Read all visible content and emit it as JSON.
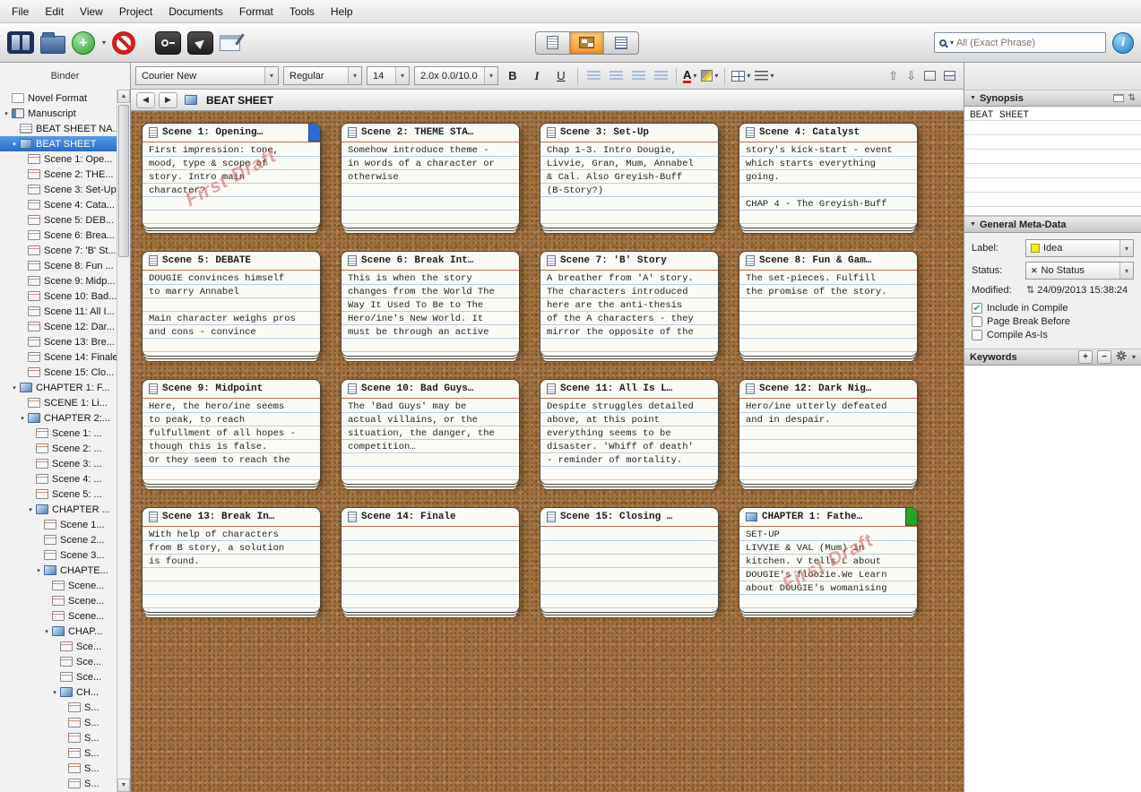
{
  "menubar": {
    "items": [
      "File",
      "Edit",
      "View",
      "Project",
      "Documents",
      "Format",
      "Tools",
      "Help"
    ]
  },
  "toolbar": {
    "search_placeholder": "All (Exact Phrase)",
    "info_label": "i"
  },
  "formatbar": {
    "font": "Courier New",
    "style": "Regular",
    "size": "14",
    "spacing": "2.0x 0.0/10.0",
    "bold": "B",
    "italic": "I",
    "underline": "U",
    "color_letter": "A"
  },
  "editor": {
    "title": "BEAT SHEET"
  },
  "binder": {
    "title": "Binder",
    "items": [
      {
        "label": "Novel Format",
        "depth": 0,
        "icon": "page"
      },
      {
        "label": "Manuscript",
        "depth": 0,
        "icon": "book",
        "children": true
      },
      {
        "label": "BEAT SHEET NA...",
        "depth": 1,
        "icon": "doc"
      },
      {
        "label": "BEAT SHEET",
        "depth": 1,
        "icon": "stack",
        "children": true,
        "selected": true
      },
      {
        "label": "Scene 1: Ope...",
        "depth": 2,
        "icon": "card"
      },
      {
        "label": "Scene 2: THE...",
        "depth": 2,
        "icon": "card"
      },
      {
        "label": "Scene 3: Set-Up",
        "depth": 2,
        "icon": "card"
      },
      {
        "label": "Scene 4: Cata...",
        "depth": 2,
        "icon": "card"
      },
      {
        "label": "Scene 5: DEB...",
        "depth": 2,
        "icon": "card"
      },
      {
        "label": "Scene 6: Brea...",
        "depth": 2,
        "icon": "card"
      },
      {
        "label": "Scene 7: 'B' St...",
        "depth": 2,
        "icon": "card"
      },
      {
        "label": "Scene 8: Fun ...",
        "depth": 2,
        "icon": "card"
      },
      {
        "label": "Scene 9: Midp...",
        "depth": 2,
        "icon": "card"
      },
      {
        "label": "Scene 10: Bad...",
        "depth": 2,
        "icon": "card"
      },
      {
        "label": "Scene 11: All I...",
        "depth": 2,
        "icon": "card"
      },
      {
        "label": "Scene 12: Dar...",
        "depth": 2,
        "icon": "card"
      },
      {
        "label": "Scene 13: Bre...",
        "depth": 2,
        "icon": "card"
      },
      {
        "label": "Scene 14: Finale",
        "depth": 2,
        "icon": "card"
      },
      {
        "label": "Scene 15: Clo...",
        "depth": 2,
        "icon": "card"
      },
      {
        "label": "CHAPTER 1: F...",
        "depth": 1,
        "icon": "stack",
        "children": true
      },
      {
        "label": "SCENE 1: Li...",
        "depth": 2,
        "icon": "card"
      },
      {
        "label": "CHAPTER 2:...",
        "depth": 2,
        "icon": "stack",
        "children": true
      },
      {
        "label": "Scene 1: ...",
        "depth": 3,
        "icon": "card"
      },
      {
        "label": "Scene 2: ...",
        "depth": 3,
        "icon": "card"
      },
      {
        "label": "Scene 3: ...",
        "depth": 3,
        "icon": "card"
      },
      {
        "label": "Scene 4: ...",
        "depth": 3,
        "icon": "card"
      },
      {
        "label": "Scene 5: ...",
        "depth": 3,
        "icon": "card"
      },
      {
        "label": "CHAPTER ...",
        "depth": 3,
        "icon": "stack",
        "children": true
      },
      {
        "label": "Scene 1...",
        "depth": 4,
        "icon": "card"
      },
      {
        "label": "Scene 2...",
        "depth": 4,
        "icon": "card"
      },
      {
        "label": "Scene 3...",
        "depth": 4,
        "icon": "card"
      },
      {
        "label": "CHAPTE...",
        "depth": 4,
        "icon": "stack",
        "children": true
      },
      {
        "label": "Scene...",
        "depth": 5,
        "icon": "card"
      },
      {
        "label": "Scene...",
        "depth": 5,
        "icon": "card"
      },
      {
        "label": "Scene...",
        "depth": 5,
        "icon": "card"
      },
      {
        "label": "CHAP...",
        "depth": 5,
        "icon": "stack",
        "children": true
      },
      {
        "label": "Sce...",
        "depth": 6,
        "icon": "card"
      },
      {
        "label": "Sce...",
        "depth": 6,
        "icon": "card"
      },
      {
        "label": "Sce...",
        "depth": 6,
        "icon": "card"
      },
      {
        "label": "CH...",
        "depth": 6,
        "icon": "stack",
        "children": true
      },
      {
        "label": "S...",
        "depth": 7,
        "icon": "card"
      },
      {
        "label": "S...",
        "depth": 7,
        "icon": "card"
      },
      {
        "label": "S...",
        "depth": 7,
        "icon": "card"
      },
      {
        "label": "S...",
        "depth": 7,
        "icon": "card"
      },
      {
        "label": "S...",
        "depth": 7,
        "icon": "card"
      },
      {
        "label": "S...",
        "depth": 7,
        "icon": "card"
      }
    ]
  },
  "corkboard": {
    "watermark": "First Draft",
    "watermark_color": "#d65c5c",
    "cards": [
      {
        "title": "Scene 1: Opening…",
        "body": "First impression: tone,\nmood, type & scope of\nstory. Intro main\ncharacter?",
        "label_color": "#2b6cd4",
        "watermark": true
      },
      {
        "title": "Scene 2: THEME STA…",
        "body": "Somehow introduce theme -\nin words of a character or\notherwise"
      },
      {
        "title": "Scene 3: Set-Up",
        "body": "Chap 1-3. Intro Dougie,\nLivvie, Gran, Mum, Annabel\n& Cal. Also Greyish-Buff\n(B-Story?)"
      },
      {
        "title": "Scene 4: Catalyst",
        "body": "story's kick-start - event\nwhich starts everything\ngoing.\n\nCHAP 4 - The Greyish-Buff"
      },
      {
        "title": "Scene 5: DEBATE",
        "body": "DOUGIE convinces himself\nto marry Annabel\n\nMain character weighs pros\nand cons - convince"
      },
      {
        "title": "Scene 6: Break Int…",
        "body": "This is when the story\nchanges from the World The\nWay It Used To Be to The\nHero/ine's New World. It\nmust be through an active"
      },
      {
        "title": "Scene 7: 'B' Story",
        "body": "A breather from 'A' story.\nThe characters introduced\nhere are the anti-thesis\nof the A characters - they\nmirror the opposite of the"
      },
      {
        "title": "Scene 8: Fun & Gam…",
        "body": "The set-pieces. Fulfill\nthe promise of the story."
      },
      {
        "title": "Scene 9: Midpoint",
        "body": "Here, the hero/ine seems\nto peak, to reach\nfulfullment of all hopes -\nthough this is false.\nOr they seem to reach the"
      },
      {
        "title": "Scene 10: Bad Guys…",
        "body": "The 'Bad Guys' may be\nactual villains, or the\nsituation, the danger, the\ncompetition…"
      },
      {
        "title": "Scene 11: All Is L…",
        "body": "Despite struggles detailed\nabove, at this point\neverything seems to be\ndisaster. 'Whiff of death'\n- reminder of mortality."
      },
      {
        "title": "Scene 12: Dark Nig…",
        "body": "Hero/ine utterly defeated\nand in despair."
      },
      {
        "title": "Scene 13: Break In…",
        "body": "With help of characters\nfrom B story, a solution\nis found."
      },
      {
        "title": "Scene 14: Finale",
        "body": ""
      },
      {
        "title": "Scene 15: Closing …",
        "body": ""
      },
      {
        "title": "CHAPTER 1: Fathe…",
        "body": "SET-UP\nLIVVIE & VAL (Mum) in\nkitchen. V tells L about\nDOUGIE's floozie.We Learn\nabout DOUGIE's womanising",
        "label_color": "#22a322",
        "watermark": true,
        "icon": "stack"
      }
    ]
  },
  "inspector": {
    "synopsis": {
      "header": "Synopsis",
      "text": "BEAT SHEET"
    },
    "meta": {
      "header": "General Meta-Data",
      "label_caption": "Label:",
      "label_value": "Idea",
      "label_chip_color": "#f2ef0c",
      "status_caption": "Status:",
      "status_value": "No Status",
      "modified_caption": "Modified:",
      "modified_value": "24/09/2013 15:38:24",
      "checks": [
        {
          "label": "Include in Compile",
          "checked": true
        },
        {
          "label": "Page Break Before",
          "checked": false
        },
        {
          "label": "Compile As-Is",
          "checked": false
        }
      ]
    },
    "keywords": {
      "header": "Keywords"
    }
  },
  "glyphs": {
    "dropdown": "▾",
    "back": "◀",
    "forward": "▶",
    "scroll_up": "▲",
    "scroll_down": "▼",
    "section_collapse": "▼",
    "expand": "▾",
    "plus": "+",
    "minus": "−",
    "no_status": "✕",
    "updown": "⇅",
    "nav_up": "⇧",
    "nav_down": "⇩",
    "check": "✔"
  }
}
